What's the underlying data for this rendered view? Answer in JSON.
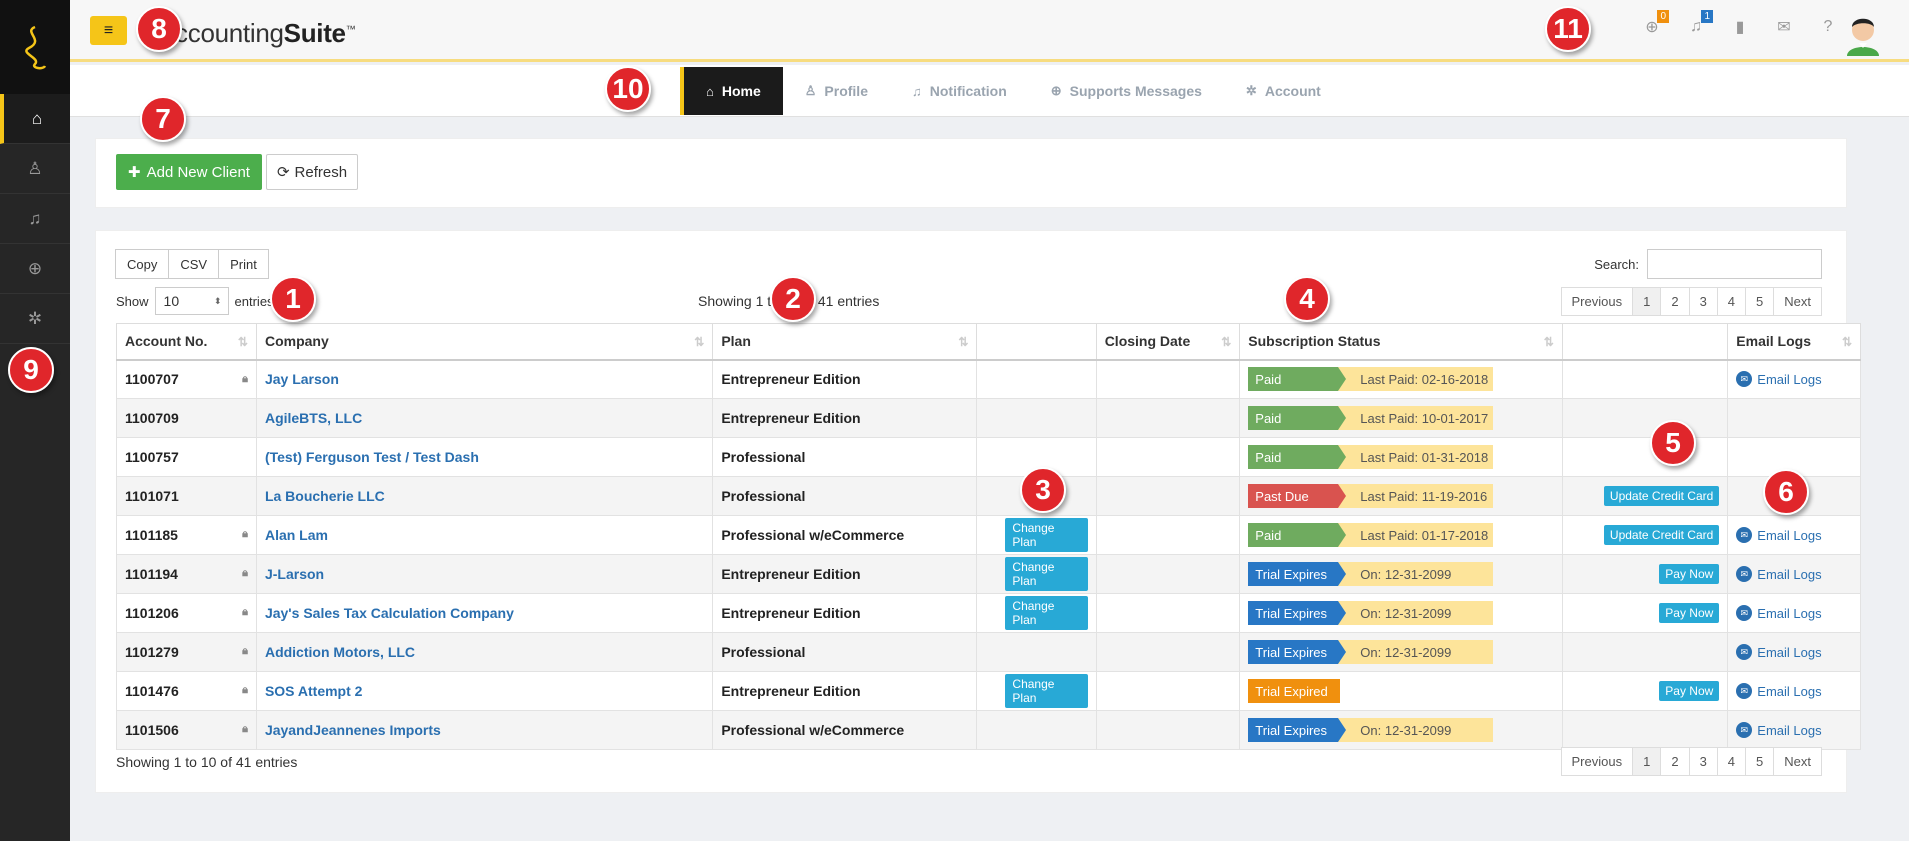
{
  "header": {
    "menu_icon": "hamburger-icon",
    "brand_regular": "Accounting",
    "brand_bold": "Suite",
    "brand_tm": "™",
    "icons": [
      {
        "name": "support-icon",
        "badge": "0",
        "badge_color": "#f0900e"
      },
      {
        "name": "bell-icon",
        "badge": "1",
        "badge_color": "#2877c5"
      },
      {
        "name": "book-icon",
        "badge": ""
      },
      {
        "name": "mail-icon",
        "badge": ""
      },
      {
        "name": "help-icon",
        "badge": ""
      }
    ]
  },
  "sidebar": {
    "items": [
      {
        "name": "home",
        "icon": "home-icon",
        "glyph": "⌂"
      },
      {
        "name": "profile",
        "icon": "user-icon",
        "glyph": "♙"
      },
      {
        "name": "notification",
        "icon": "bell-icon",
        "glyph": "♫"
      },
      {
        "name": "support",
        "icon": "lifebuoy-icon",
        "glyph": "⊕"
      },
      {
        "name": "account",
        "icon": "gear-icon",
        "glyph": "✲"
      }
    ]
  },
  "nav": {
    "tabs": [
      {
        "label": "Home",
        "icon": "⌂",
        "active": true
      },
      {
        "label": "Profile",
        "icon": "♙",
        "active": false
      },
      {
        "label": "Notification",
        "icon": "♫",
        "active": false
      },
      {
        "label": "Supports Messages",
        "icon": "⊕",
        "active": false
      },
      {
        "label": "Account",
        "icon": "✲",
        "active": false
      }
    ]
  },
  "actions": {
    "add_label": "Add New Client",
    "refresh_label": "Refresh"
  },
  "table_tools": {
    "copy": "Copy",
    "csv": "CSV",
    "print": "Print",
    "search_label": "Search:",
    "show_label": "Show",
    "show_value": "10",
    "entries_label": "entries",
    "info_top": "Showing 1 to 10 of 41 entries",
    "info_bottom": "Showing 1 to 10 of 41 entries",
    "pager": [
      "Previous",
      "1",
      "2",
      "3",
      "4",
      "5",
      "Next"
    ]
  },
  "columns": [
    "Account No.",
    "Company",
    "Plan",
    "",
    "Closing Date",
    "Subscription Status",
    "",
    "Email Logs"
  ],
  "rows": [
    {
      "acc": "1100707",
      "lock": true,
      "company": "Jay Larson",
      "plan": "Entrepreneur Edition",
      "change": "",
      "closing": "",
      "status": "Paid",
      "status_type": "paid",
      "note": "Last Paid: 02-16-2018",
      "action": "",
      "email": "Email Logs"
    },
    {
      "acc": "1100709",
      "lock": false,
      "company": "AgileBTS, LLC",
      "plan": "Entrepreneur Edition",
      "change": "",
      "closing": "",
      "status": "Paid",
      "status_type": "paid",
      "note": "Last Paid: 10-01-2017",
      "action": "",
      "email": ""
    },
    {
      "acc": "1100757",
      "lock": false,
      "company": "(Test) Ferguson Test / Test Dash",
      "plan": "Professional",
      "change": "",
      "closing": "",
      "status": "Paid",
      "status_type": "paid",
      "note": "Last Paid: 01-31-2018",
      "action": "",
      "email": ""
    },
    {
      "acc": "1101071",
      "lock": false,
      "company": "La Boucherie LLC",
      "plan": "Professional",
      "change": "",
      "closing": "",
      "status": "Past Due",
      "status_type": "past",
      "note": "Last Paid: 11-19-2016",
      "action": "Update Credit Card",
      "email": ""
    },
    {
      "acc": "1101185",
      "lock": true,
      "company": "Alan Lam",
      "plan": "Professional w/eCommerce",
      "change": "Change Plan",
      "closing": "",
      "status": "Paid",
      "status_type": "paid",
      "note": "Last Paid: 01-17-2018",
      "action": "Update Credit Card",
      "email": "Email Logs"
    },
    {
      "acc": "1101194",
      "lock": true,
      "company": "J-Larson",
      "plan": "Entrepreneur Edition",
      "change": "Change Plan",
      "closing": "",
      "status": "Trial Expires",
      "status_type": "trial",
      "note": "On: 12-31-2099",
      "action": "Pay Now",
      "email": "Email Logs"
    },
    {
      "acc": "1101206",
      "lock": true,
      "company": "Jay's Sales Tax Calculation Company",
      "plan": "Entrepreneur Edition",
      "change": "Change Plan",
      "closing": "",
      "status": "Trial Expires",
      "status_type": "trial",
      "note": "On: 12-31-2099",
      "action": "Pay Now",
      "email": "Email Logs"
    },
    {
      "acc": "1101279",
      "lock": true,
      "company": "Addiction Motors, LLC",
      "plan": "Professional",
      "change": "",
      "closing": "",
      "status": "Trial Expires",
      "status_type": "trial",
      "note": "On: 12-31-2099",
      "action": "",
      "email": "Email Logs"
    },
    {
      "acc": "1101476",
      "lock": true,
      "company": "SOS Attempt 2",
      "plan": "Entrepreneur Edition",
      "change": "Change Plan",
      "closing": "",
      "status": "Trial Expired",
      "status_type": "expired",
      "note": "",
      "action": "Pay Now",
      "email": "Email Logs"
    },
    {
      "acc": "1101506",
      "lock": true,
      "company": "JayandJeannenes Imports",
      "plan": "Professional w/eCommerce",
      "change": "",
      "closing": "",
      "status": "Trial Expires",
      "status_type": "trial",
      "note": "On: 12-31-2099",
      "action": "",
      "email": "Email Logs"
    }
  ],
  "markers": [
    "1",
    "2",
    "3",
    "4",
    "5",
    "6",
    "7",
    "8",
    "9",
    "10",
    "11"
  ],
  "colors": {
    "accent": "#f5c518",
    "success": "#4cae4c",
    "info": "#28a9d6",
    "danger": "#d9534f",
    "primary": "#2877c5",
    "warning": "#f0900e",
    "link": "#2a6fb0"
  }
}
